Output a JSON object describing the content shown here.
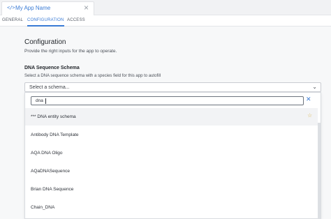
{
  "app_tab": {
    "title": "My App Name",
    "icon": "code-icon"
  },
  "nav_tabs": [
    {
      "label": "GENERAL"
    },
    {
      "label": "CONFIGURATION"
    },
    {
      "label": "ACCESS"
    }
  ],
  "active_tab": "CONFIGURATION",
  "config": {
    "heading": "Configuration",
    "subtext": "Provide the right inputs for the app to operate.",
    "section_label": "DNA Sequence Schema",
    "section_desc": "Select a DNA sequence schema with a species field for this app to autofill",
    "select_placeholder": "Select a schema..."
  },
  "dropdown": {
    "search_value": "dna",
    "items": [
      {
        "label": "*** DNA entity schema",
        "starred": true
      },
      {
        "label": "Antibody DNA Template"
      },
      {
        "label": "AQA DNA Oligo"
      },
      {
        "label": "AQaDNASequence"
      },
      {
        "label": "Brian DNA Sequence"
      },
      {
        "label": "Chain_DNA"
      }
    ]
  },
  "colors": {
    "accent": "#3a7bd5",
    "star": "#d9b34a"
  }
}
